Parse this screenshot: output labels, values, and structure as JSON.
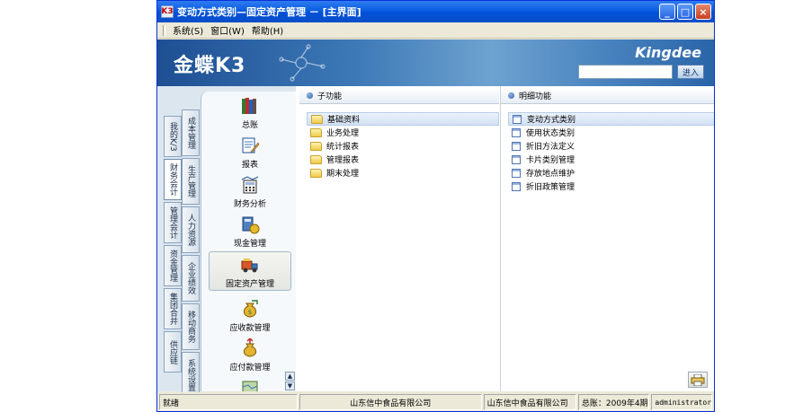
{
  "window": {
    "title": "变动方式类别—固定资产管理 － [主界面]",
    "app_icon": "K3",
    "minimize": "_",
    "maximize": "□",
    "close": "×"
  },
  "menubar": {
    "items": [
      "系统(S)",
      "窗口(W)",
      "帮助(H)"
    ]
  },
  "banner": {
    "logo": "金蝶K3",
    "brand": "Kingdee",
    "search_value": "",
    "enter_label": "进入"
  },
  "vtabs_left": [
    "我的K/3",
    "财务会计",
    "管理会计",
    "资金管理",
    "集团合并",
    "供应链"
  ],
  "vtabs_right": [
    "成本管理",
    "生产管理",
    "人力资源",
    "企业绩效",
    "移动商务",
    "系统设置"
  ],
  "modules": [
    {
      "label": "总账",
      "icon": "books-icon"
    },
    {
      "label": "报表",
      "icon": "report-edit-icon"
    },
    {
      "label": "财务分析",
      "icon": "calculator-icon"
    },
    {
      "label": "现金管理",
      "icon": "cash-calculator-icon"
    },
    {
      "label": "固定资产管理",
      "icon": "truck-icon"
    },
    {
      "label": "应收款管理",
      "icon": "money-bag-icon"
    },
    {
      "label": "应付款管理",
      "icon": "money-bag-out-icon"
    }
  ],
  "subfunctions": {
    "header": "子功能",
    "items": [
      "基础资料",
      "业务处理",
      "统计报表",
      "管理报表",
      "期末处理"
    ],
    "selected": 0
  },
  "details": {
    "header": "明细功能",
    "items": [
      "变动方式类别",
      "使用状态类别",
      "折旧方法定义",
      "卡片类别管理",
      "存放地点维护",
      "折旧政策管理"
    ],
    "selected": 0
  },
  "status": {
    "state": "就绪",
    "company1": "山东信中食品有限公司",
    "company2": "山东信中食品有限公司",
    "period": "总账：2009年4期",
    "user": "administrator"
  }
}
